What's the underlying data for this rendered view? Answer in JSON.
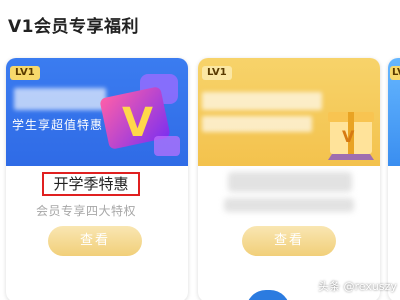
{
  "section": {
    "title": "V1会员专享福利"
  },
  "cards": [
    {
      "badge": "LV1",
      "banner_subtitle": "学生享超值特惠",
      "banner_art_letter": "V",
      "title": "开学季特惠",
      "desc": "会员专享四大特权",
      "button": "查看"
    },
    {
      "badge": "LV1",
      "gift_art_letter": "V",
      "button": "查看"
    },
    {
      "badge": "LV"
    }
  ],
  "watermark": "头条 @rexuszy",
  "colors": {
    "blue_banner": "#2f6be6",
    "yellow_banner": "#f3c24d",
    "button_gold": "#f1cf79",
    "highlight_border": "#e02020"
  }
}
